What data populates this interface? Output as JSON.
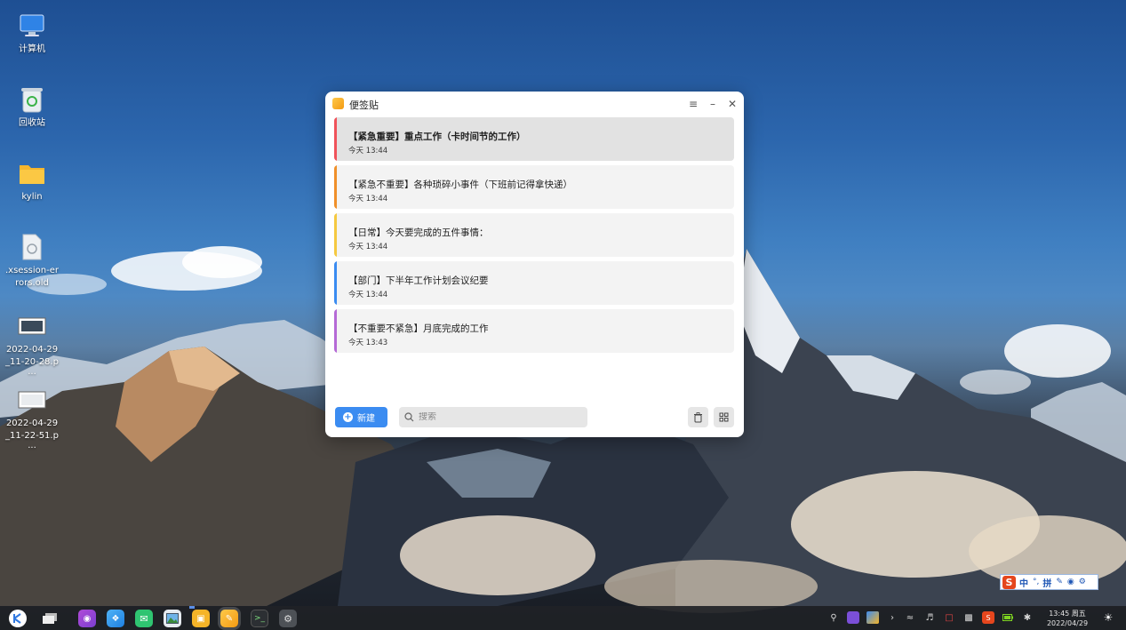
{
  "desktop": {
    "icons": [
      {
        "label": "计算机"
      },
      {
        "label": "回收站"
      },
      {
        "label": "kylin"
      },
      {
        "label": ".xsession-errors.old"
      },
      {
        "label": "2022-04-29_11-20-28.p···"
      },
      {
        "label": "2022-04-29_11-22-51.p···"
      }
    ]
  },
  "window": {
    "title": "便签贴",
    "menu_icon": "menu-icon",
    "minimize_icon": "minimize-icon",
    "close_icon": "close-icon"
  },
  "notes": [
    {
      "title": "【紧急重要】重点工作（卡时间节的工作）",
      "time": "今天  13:44",
      "color": "#f0525a",
      "selected": true
    },
    {
      "title": "【紧急不重要】各种琐碎小事件（下班前记得拿快递）",
      "time": "今天  13:44",
      "color": "#f0902a",
      "selected": false
    },
    {
      "title": "【日常】今天要完成的五件事情：",
      "time": "今天  13:44",
      "color": "#f5c940",
      "selected": false
    },
    {
      "title": "【部门】下半年工作计划会议纪要",
      "time": "今天  13:44",
      "color": "#3b8cf1",
      "selected": false
    },
    {
      "title": "【不重要不紧急】月底完成的工作",
      "time": "今天  13:43",
      "color": "#b56ad6",
      "selected": false
    }
  ],
  "toolbar": {
    "new_label": "新建",
    "search_placeholder": "搜索"
  },
  "ime": {
    "mode": "中",
    "pinyin": "拼"
  },
  "taskbar": {
    "clock_time": "13:45 周五",
    "clock_date": "2022/04/29"
  }
}
